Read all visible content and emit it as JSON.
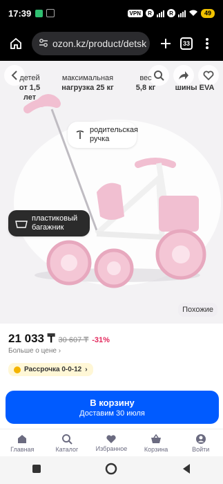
{
  "status": {
    "time": "17:39",
    "vpn": "VPN",
    "r1": "R",
    "r2": "R",
    "battery": "49"
  },
  "browser": {
    "url": "ozon.kz/product/detsk",
    "tabs": "33"
  },
  "product": {
    "specs": [
      {
        "label": "детей",
        "value": "от 1,5 лет"
      },
      {
        "label": "максимальная",
        "value": "нагрузка 25 кг"
      },
      {
        "label": "вес",
        "value": "5,8 кг"
      },
      {
        "label": "",
        "value": "шины EVA"
      }
    ],
    "callout_handle": "родительская ручка",
    "callout_basket": "пластиковый багажник",
    "similar": "Похожие"
  },
  "pricing": {
    "price": "21 033 ₸",
    "old_price": "30 607 ₸",
    "discount": "-31%",
    "more": "Больше о цене"
  },
  "installment": {
    "label": "Рассрочка 0-0-12"
  },
  "cart": {
    "label": "В корзину",
    "sub": "Доставим 30 июля"
  },
  "nav": {
    "items": [
      {
        "label": "Главная",
        "icon": "home-icon"
      },
      {
        "label": "Каталог",
        "icon": "search-icon"
      },
      {
        "label": "Избранное",
        "icon": "heart-icon"
      },
      {
        "label": "Корзина",
        "icon": "basket-icon"
      },
      {
        "label": "Войти",
        "icon": "user-icon"
      }
    ]
  },
  "colors": {
    "accent": "#005bff",
    "discount": "#e3285c",
    "bike_pink": "#f1bfd1"
  }
}
